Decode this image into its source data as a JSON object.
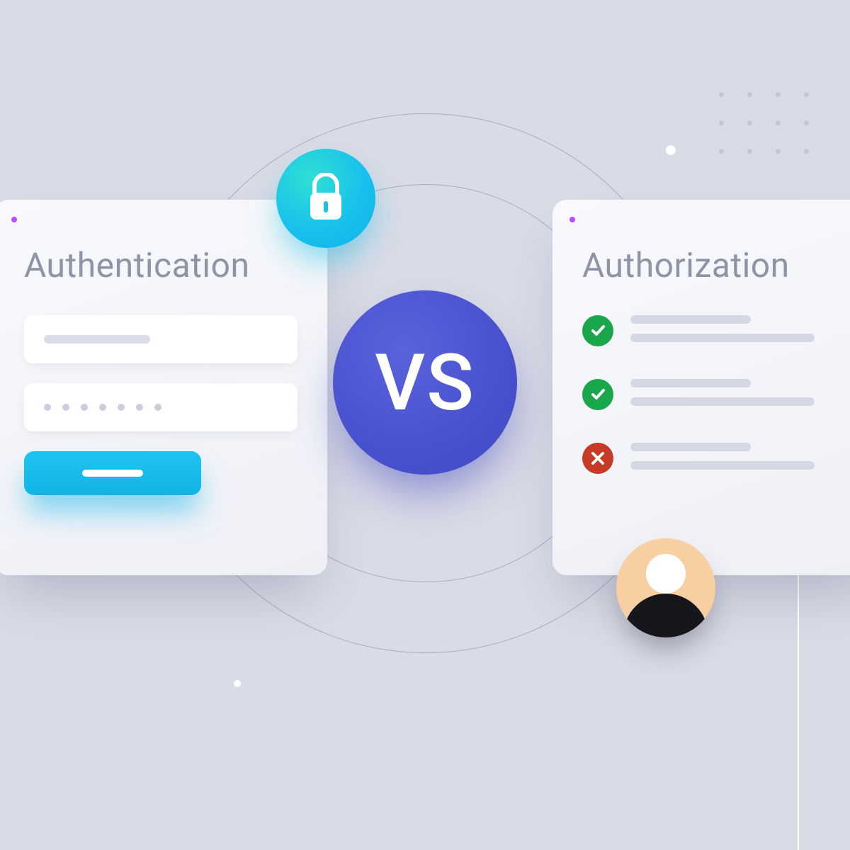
{
  "vs_label": "VS",
  "authentication": {
    "title": "Authentication",
    "password_dot_count": 7,
    "icon": "lock-icon"
  },
  "authorization": {
    "title": "Authorization",
    "permissions": [
      {
        "status": "granted"
      },
      {
        "status": "granted"
      },
      {
        "status": "denied"
      }
    ],
    "icon": "avatar-icon"
  },
  "colors": {
    "background": "#d9dbe6",
    "vs_badge": "#4a53cf",
    "lock_badge": "#18c1ec",
    "submit_button": "#12b4e6",
    "status_granted": "#1aa64a",
    "status_denied": "#c63a26",
    "avatar_skin": "#f7cfa3"
  }
}
